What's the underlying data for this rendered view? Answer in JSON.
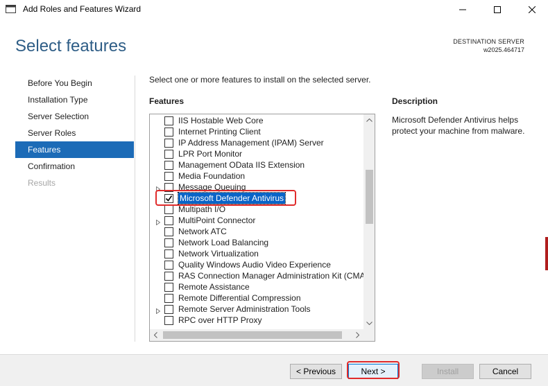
{
  "window": {
    "title": "Add Roles and Features Wizard"
  },
  "header": {
    "page_title": "Select features",
    "destination_label": "DESTINATION SERVER",
    "destination_server": "w2025.464717"
  },
  "nav": {
    "items": [
      {
        "label": "Before You Begin",
        "state": "normal"
      },
      {
        "label": "Installation Type",
        "state": "normal"
      },
      {
        "label": "Server Selection",
        "state": "normal"
      },
      {
        "label": "Server Roles",
        "state": "normal"
      },
      {
        "label": "Features",
        "state": "active"
      },
      {
        "label": "Confirmation",
        "state": "normal"
      },
      {
        "label": "Results",
        "state": "disabled"
      }
    ]
  },
  "main": {
    "intro": "Select one or more features to install on the selected server.",
    "features_heading": "Features",
    "description_heading": "Description",
    "description_text": "Microsoft Defender Antivirus helps protect your machine from malware."
  },
  "features": [
    {
      "label": "IIS Hostable Web Core",
      "checked": false,
      "expandable": false,
      "selected": false
    },
    {
      "label": "Internet Printing Client",
      "checked": false,
      "expandable": false,
      "selected": false
    },
    {
      "label": "IP Address Management (IPAM) Server",
      "checked": false,
      "expandable": false,
      "selected": false
    },
    {
      "label": "LPR Port Monitor",
      "checked": false,
      "expandable": false,
      "selected": false
    },
    {
      "label": "Management OData IIS Extension",
      "checked": false,
      "expandable": false,
      "selected": false
    },
    {
      "label": "Media Foundation",
      "checked": false,
      "expandable": false,
      "selected": false
    },
    {
      "label": "Message Queuing",
      "checked": false,
      "expandable": true,
      "selected": false
    },
    {
      "label": "Microsoft Defender Antivirus",
      "checked": true,
      "expandable": false,
      "selected": true
    },
    {
      "label": "Multipath I/O",
      "checked": false,
      "expandable": false,
      "selected": false
    },
    {
      "label": "MultiPoint Connector",
      "checked": false,
      "expandable": true,
      "selected": false
    },
    {
      "label": "Network ATC",
      "checked": false,
      "expandable": false,
      "selected": false
    },
    {
      "label": "Network Load Balancing",
      "checked": false,
      "expandable": false,
      "selected": false
    },
    {
      "label": "Network Virtualization",
      "checked": false,
      "expandable": false,
      "selected": false
    },
    {
      "label": "Quality Windows Audio Video Experience",
      "checked": false,
      "expandable": false,
      "selected": false
    },
    {
      "label": "RAS Connection Manager Administration Kit (CMA",
      "checked": false,
      "expandable": false,
      "selected": false
    },
    {
      "label": "Remote Assistance",
      "checked": false,
      "expandable": false,
      "selected": false
    },
    {
      "label": "Remote Differential Compression",
      "checked": false,
      "expandable": false,
      "selected": false
    },
    {
      "label": "Remote Server Administration Tools",
      "checked": false,
      "expandable": true,
      "selected": false
    },
    {
      "label": "RPC over HTTP Proxy",
      "checked": false,
      "expandable": false,
      "selected": false
    }
  ],
  "footer": {
    "previous_label": "< Previous",
    "next_label": "Next >",
    "install_label": "Install",
    "cancel_label": "Cancel"
  },
  "colors": {
    "accent": "#1c6bb7",
    "heading": "#2e5d86",
    "selection": "#0a64c7",
    "annotation": "#e02b2b"
  }
}
